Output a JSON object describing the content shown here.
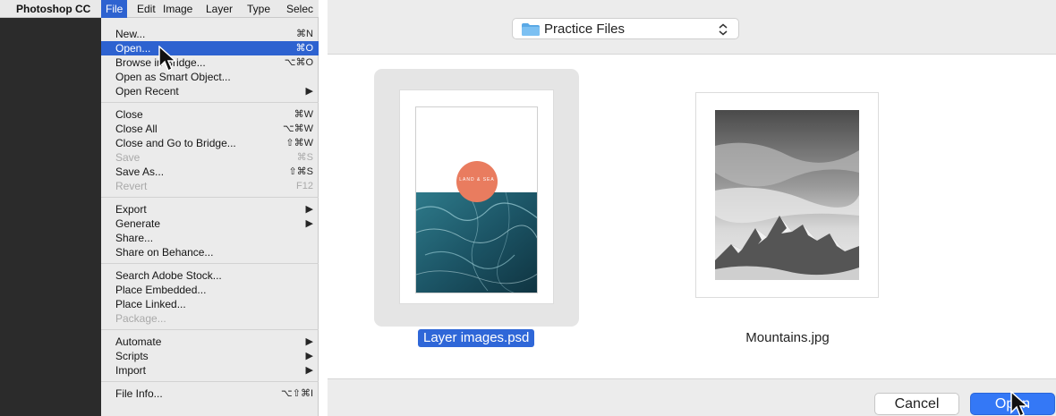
{
  "menubar": {
    "app_name": "Photoshop CC",
    "items": [
      "File",
      "Edit",
      "Image",
      "Layer",
      "Type",
      "Selec"
    ]
  },
  "file_menu": {
    "groups": [
      [
        {
          "label": "New...",
          "shortcut": "⌘N"
        },
        {
          "label": "Open...",
          "shortcut": "⌘O",
          "highlighted": true
        },
        {
          "label": "Browse in Bridge...",
          "shortcut": "⌥⌘O"
        },
        {
          "label": "Open as Smart Object...",
          "shortcut": ""
        },
        {
          "label": "Open Recent",
          "shortcut": "▶"
        }
      ],
      [
        {
          "label": "Close",
          "shortcut": "⌘W"
        },
        {
          "label": "Close All",
          "shortcut": "⌥⌘W"
        },
        {
          "label": "Close and Go to Bridge...",
          "shortcut": "⇧⌘W"
        },
        {
          "label": "Save",
          "shortcut": "⌘S",
          "disabled": true
        },
        {
          "label": "Save As...",
          "shortcut": "⇧⌘S"
        },
        {
          "label": "Revert",
          "shortcut": "F12",
          "disabled": true
        }
      ],
      [
        {
          "label": "Export",
          "shortcut": "▶"
        },
        {
          "label": "Generate",
          "shortcut": "▶"
        },
        {
          "label": "Share...",
          "shortcut": ""
        },
        {
          "label": "Share on Behance...",
          "shortcut": ""
        }
      ],
      [
        {
          "label": "Search Adobe Stock...",
          "shortcut": ""
        },
        {
          "label": "Place Embedded...",
          "shortcut": ""
        },
        {
          "label": "Place Linked...",
          "shortcut": ""
        },
        {
          "label": "Package...",
          "shortcut": "",
          "disabled": true
        }
      ],
      [
        {
          "label": "Automate",
          "shortcut": "▶"
        },
        {
          "label": "Scripts",
          "shortcut": "▶"
        },
        {
          "label": "Import",
          "shortcut": "▶"
        }
      ],
      [
        {
          "label": "File Info...",
          "shortcut": "⌥⇧⌘I"
        }
      ]
    ]
  },
  "dialog": {
    "location": "Practice Files",
    "files": [
      {
        "name": "Layer images.psd",
        "selected": true,
        "circle_text": "LAND & SEA"
      },
      {
        "name": "Mountains.jpg",
        "selected": false
      }
    ],
    "cancel_label": "Cancel",
    "open_label": "Open"
  },
  "colors": {
    "menu_highlight": "#2d62d0",
    "open_button": "#3478f6",
    "circle": "#e97c5f"
  }
}
